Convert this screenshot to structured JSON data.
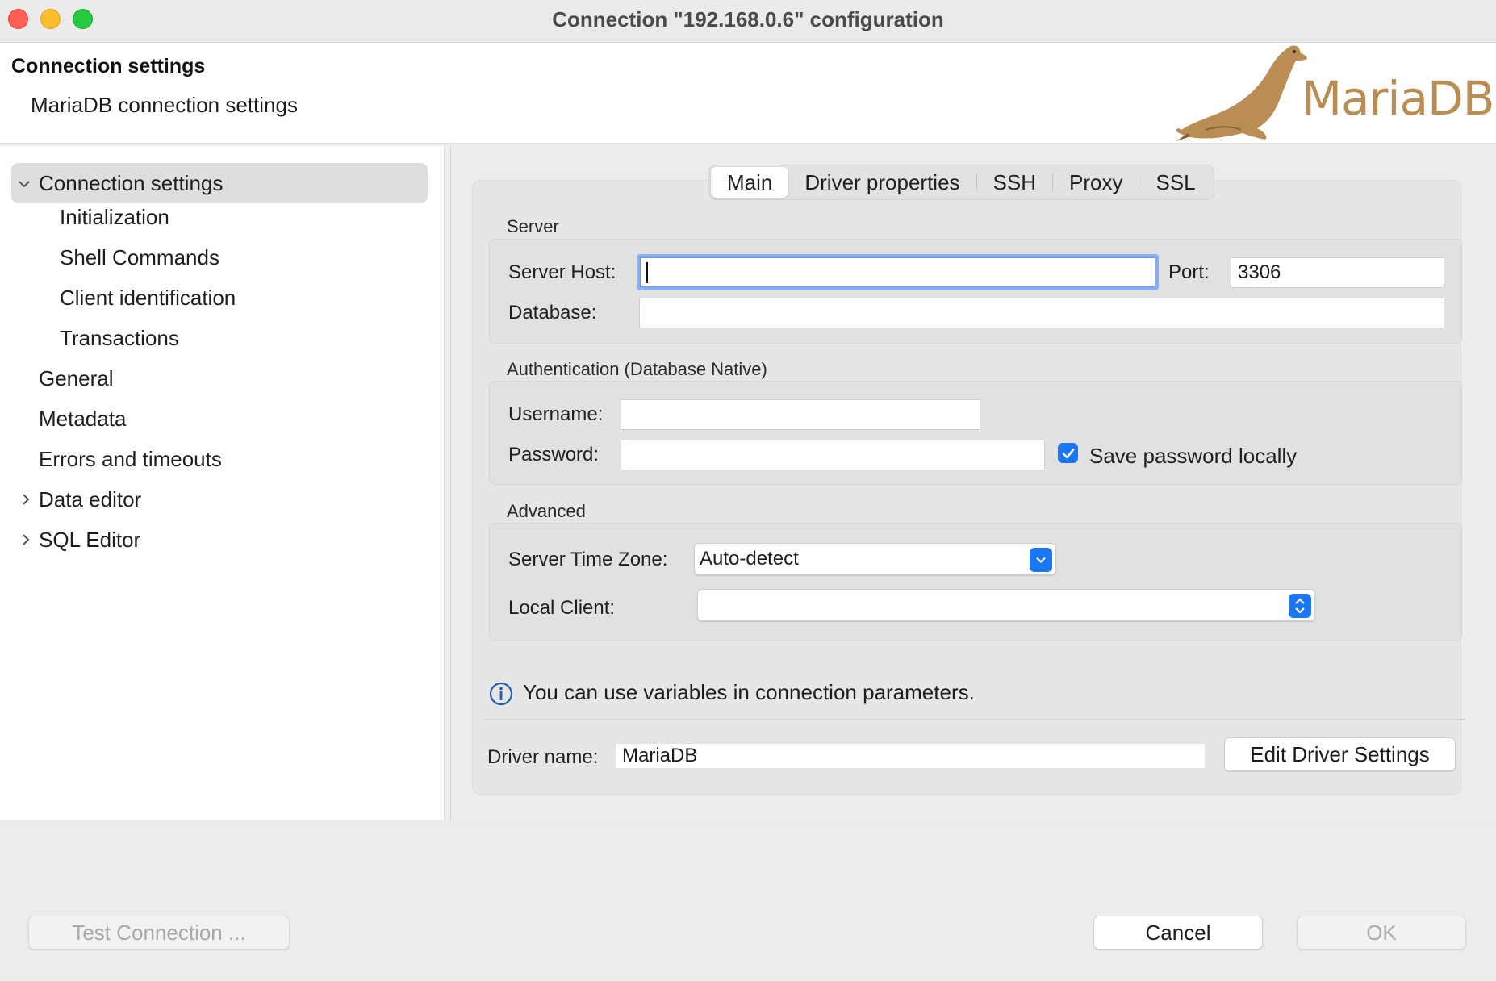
{
  "window": {
    "title": "Connection \"192.168.0.6\" configuration"
  },
  "header": {
    "title": "Connection settings",
    "subtitle": "MariaDB connection settings",
    "logo_text": "MariaDB"
  },
  "sidebar": {
    "items": [
      {
        "label": "Connection settings",
        "expanded": true,
        "selected": true
      },
      {
        "label": "Initialization"
      },
      {
        "label": "Shell Commands"
      },
      {
        "label": "Client identification"
      },
      {
        "label": "Transactions"
      },
      {
        "label": "General"
      },
      {
        "label": "Metadata"
      },
      {
        "label": "Errors and timeouts"
      },
      {
        "label": "Data editor",
        "expandable": true
      },
      {
        "label": "SQL Editor",
        "expandable": true
      }
    ]
  },
  "tabs": [
    "Main",
    "Driver properties",
    "SSH",
    "Proxy",
    "SSL"
  ],
  "active_tab": "Main",
  "server": {
    "group_label": "Server",
    "host_label": "Server Host:",
    "host_value": "",
    "port_label": "Port:",
    "port_value": "3306",
    "database_label": "Database:",
    "database_value": ""
  },
  "auth": {
    "group_label": "Authentication (Database Native)",
    "username_label": "Username:",
    "username_value": "",
    "password_label": "Password:",
    "password_value": "",
    "save_password_label": "Save password locally",
    "save_password_checked": true
  },
  "advanced": {
    "group_label": "Advanced",
    "timezone_label": "Server Time Zone:",
    "timezone_value": "Auto-detect",
    "local_client_label": "Local Client:",
    "local_client_value": ""
  },
  "info": {
    "text": "You can use variables in connection parameters."
  },
  "driver": {
    "name_label": "Driver name:",
    "name_value": "MariaDB",
    "edit_button": "Edit Driver Settings"
  },
  "footer": {
    "test_button": "Test Connection ...",
    "cancel_button": "Cancel",
    "ok_button": "OK"
  },
  "colors": {
    "accent": "#1a76f2",
    "focus_ring": "#8aaef5",
    "brand": "#b98d54"
  }
}
